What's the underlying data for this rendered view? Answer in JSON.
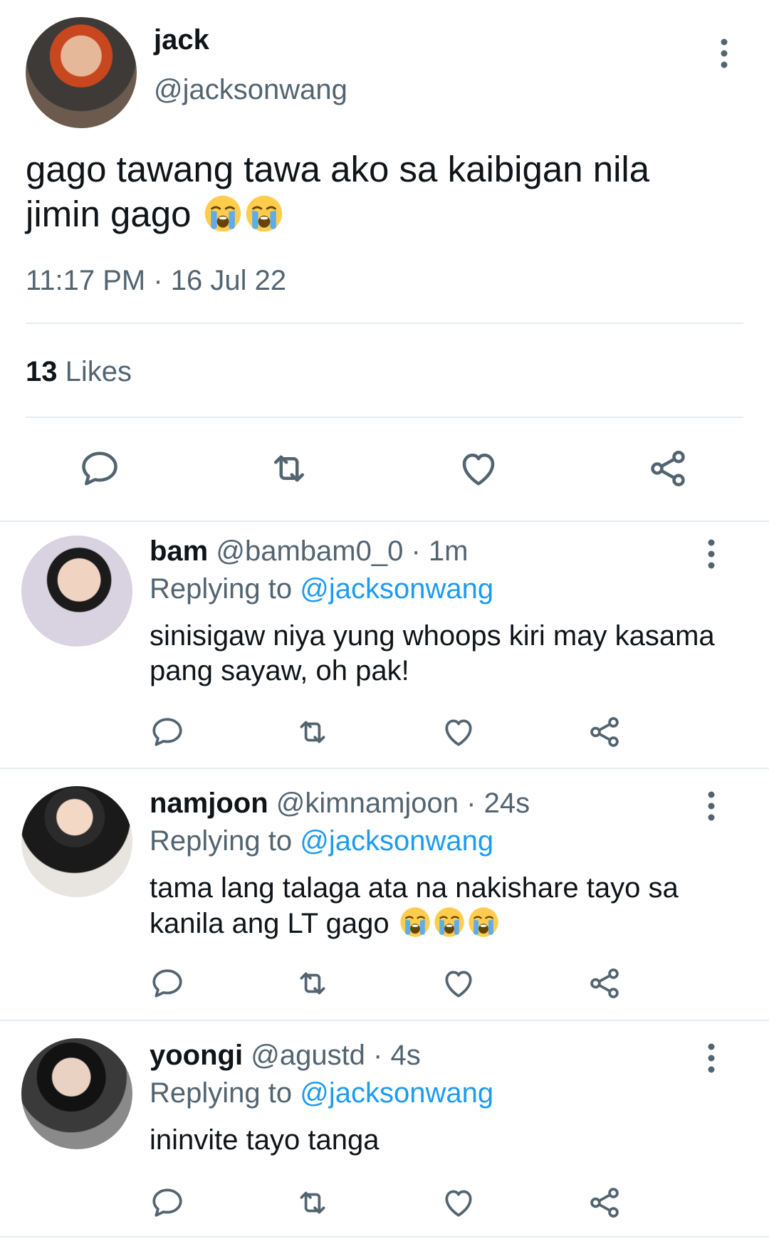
{
  "main_tweet": {
    "name": "jack",
    "handle": "@jacksonwang",
    "text": "gago tawang tawa ako sa kaibigan nila jimin gago",
    "emojis": [
      "loudly-crying-face",
      "loudly-crying-face"
    ],
    "timestamp": "11:17 PM · 16 Jul 22",
    "likes_count": "13",
    "likes_label": "Likes"
  },
  "actions": [
    "reply-icon",
    "retweet-icon",
    "like-icon",
    "share-icon"
  ],
  "replies": [
    {
      "name": "bam",
      "handle": "@bambam0_0 · 1m",
      "replying_label": "Replying to",
      "replying_to": "@jacksonwang",
      "text": "sinisigaw niya yung whoops kiri may kasama pang sayaw, oh pak!",
      "emojis": []
    },
    {
      "name": "namjoon",
      "handle": "@kimnamjoon · 24s",
      "replying_label": "Replying to",
      "replying_to": "@jacksonwang",
      "text": "tama lang talaga ata na nakishare tayo sa kanila ang LT gago",
      "emojis": [
        "loudly-crying-face",
        "loudly-crying-face",
        "loudly-crying-face"
      ]
    },
    {
      "name": "yoongi",
      "handle": "@agustd · 4s",
      "replying_label": "Replying to",
      "replying_to": "@jacksonwang",
      "text": "ininvite tayo tanga",
      "emojis": []
    }
  ],
  "colors": {
    "text": "#0f1419",
    "secondary": "#536471",
    "link": "#1d9bf0",
    "divider": "#e6ecf0"
  }
}
